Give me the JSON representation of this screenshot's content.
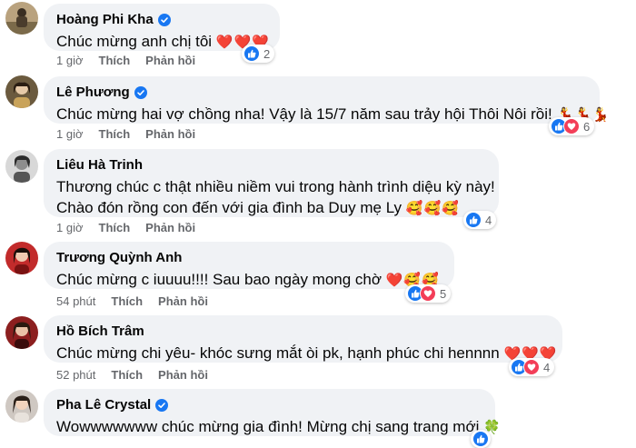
{
  "comments": [
    {
      "name": "Hoàng Phi Kha",
      "text": "Chúc mừng anh chị tôi",
      "emojis": "❤️❤️❤️",
      "time": "1 giờ",
      "like_label": "Thích",
      "reply_label": "Phản hồi",
      "reaction_count": "2"
    },
    {
      "name": "Lê Phương",
      "text": "Chúc mừng hai vợ chồng nha! Vậy là 15/7 năm sau trảy hội Thôi Nôi rồi!",
      "emojis": "💃💃💃",
      "time": "1 giờ",
      "like_label": "Thích",
      "reply_label": "Phản hồi",
      "reaction_count": "6"
    },
    {
      "name": "Liêu Hà Trinh",
      "text": "Thương chúc c thật nhiều niềm vui trong hành trình diệu kỳ này!",
      "text2": "Chào đón rồng con đến với gia đình ba Duy mẹ Ly",
      "emojis": "🥰🥰🥰",
      "time": "1 giờ",
      "like_label": "Thích",
      "reply_label": "Phản hồi",
      "reaction_count": "4"
    },
    {
      "name": "Trương Quỳnh Anh",
      "text": "Chúc mừng c iuuuu!!!! Sau bao ngày mong chờ",
      "emojis": "❤️🥰🥰",
      "time": "54 phút",
      "like_label": "Thích",
      "reply_label": "Phản hồi",
      "reaction_count": "5"
    },
    {
      "name": "Hồ Bích Trâm",
      "text": "Chúc mừng chi yêu- khóc sưng mắt òi pk, hạnh phúc chi hennnn",
      "emojis": "❤️❤️❤️",
      "time": "52 phút",
      "like_label": "Thích",
      "reply_label": "Phản hồi",
      "reaction_count": "4"
    },
    {
      "name": "Pha Lê Crystal",
      "text": "Wowwwwwww chúc mừng gia đình! Mừng chị sang trang mới",
      "emojis": "🍀"
    }
  ],
  "colors": {
    "bubble": "#f0f2f5",
    "like_blue": "#1877f2",
    "love_red": "#f33e58",
    "meta_gray": "#65676b"
  },
  "icons": {
    "verified": "verified-badge-icon",
    "like": "thumbs-up-icon",
    "love": "heart-icon"
  }
}
